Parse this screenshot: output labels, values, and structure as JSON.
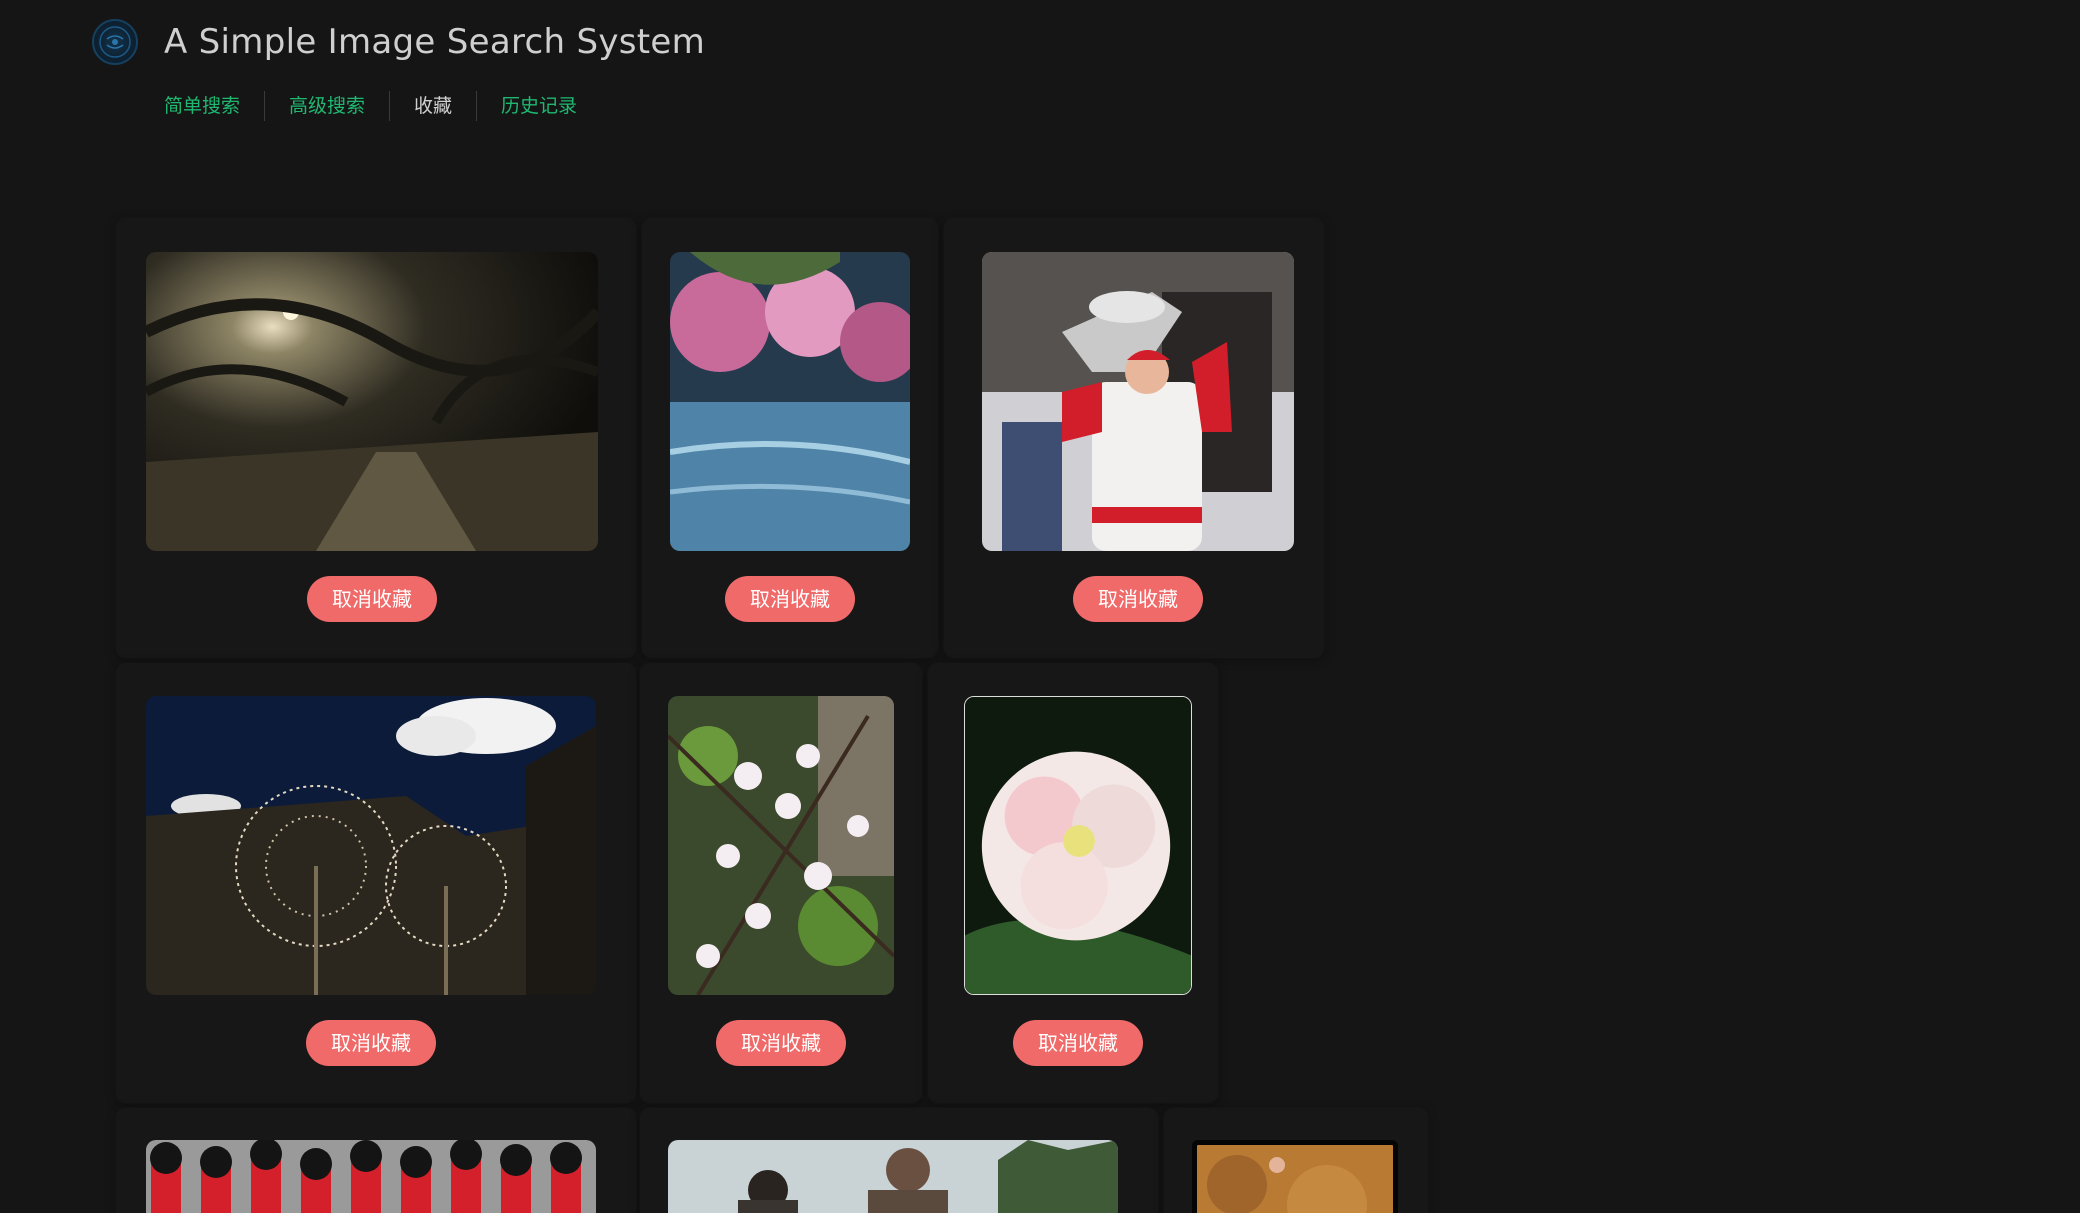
{
  "app": {
    "title": "A Simple Image Search System",
    "logo_icon": "ecnu-logo-icon"
  },
  "nav": {
    "items": [
      {
        "label": "简单搜索",
        "active": false
      },
      {
        "label": "高级搜索",
        "active": false
      },
      {
        "label": "收藏",
        "active": true
      },
      {
        "label": "历史记录",
        "active": false
      }
    ],
    "link_color": "#1fb871"
  },
  "favorites": {
    "button_color": "#f06a6a",
    "items": [
      {
        "image": "tree-tunnel-path-photo",
        "button_label": "取消收藏"
      },
      {
        "image": "cherry-blossom-lake-photo",
        "button_label": "取消收藏"
      },
      {
        "image": "hockey-player-stanley-cup-photo",
        "button_label": "取消收藏"
      },
      {
        "image": "dandelion-fountain-photo",
        "button_label": "取消收藏"
      },
      {
        "image": "white-blossom-branch-photo",
        "button_label": "取消收藏"
      },
      {
        "image": "pink-peony-flower-photo",
        "button_label": "取消收藏"
      },
      {
        "image": "marching-guards-photo"
      },
      {
        "image": "people-outdoors-photo"
      },
      {
        "image": "rock-climbing-photo"
      }
    ]
  }
}
